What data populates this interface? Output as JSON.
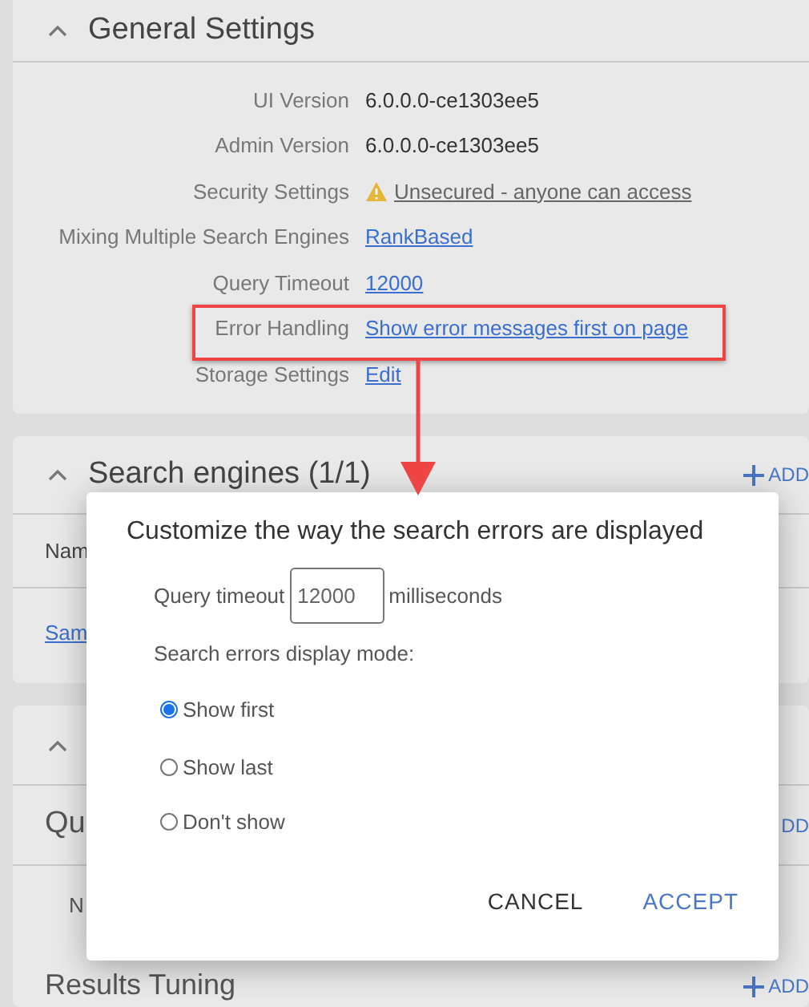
{
  "general_settings": {
    "title": "General Settings",
    "expanded": true,
    "rows": [
      {
        "label": "UI Version",
        "value": "6.0.0.0-ce1303ee5",
        "kind": "text"
      },
      {
        "label": "Admin Version",
        "value": "6.0.0.0-ce1303ee5",
        "kind": "text"
      },
      {
        "label": "Security Settings",
        "value": "Unsecured - anyone can access",
        "kind": "warning_link"
      },
      {
        "label": "Mixing Multiple Search Engines",
        "value": "RankBased",
        "kind": "link"
      },
      {
        "label": "Query Timeout",
        "value": "12000",
        "kind": "link"
      },
      {
        "label": "Error Handling",
        "value": "Show error messages first on page",
        "kind": "link"
      },
      {
        "label": "Storage Settings",
        "value": "Edit",
        "kind": "link"
      }
    ]
  },
  "search_engines": {
    "title": "Search engines (1/1)",
    "expanded": true,
    "add": "ADD",
    "column_1": "Nam",
    "row_1": "Sam"
  },
  "section_3": {
    "expanded": true,
    "subsection": "Qu",
    "add": "DD",
    "column_1": "N"
  },
  "results_tuning": {
    "title": "Results Tuning",
    "add": "ADD"
  },
  "dialog": {
    "title": "Customize the way the search errors are displayed",
    "timeout_label": "Query timeout",
    "timeout_value": "12000",
    "timeout_unit": "milliseconds",
    "mode_label": "Search errors display mode:",
    "options": [
      {
        "label": "Show first",
        "selected": true
      },
      {
        "label": "Show last",
        "selected": false
      },
      {
        "label": "Don't show",
        "selected": false
      }
    ],
    "buttons": [
      {
        "label": "CANCEL",
        "kind": "secondary"
      },
      {
        "label": "ACCEPT",
        "kind": "primary"
      }
    ]
  }
}
